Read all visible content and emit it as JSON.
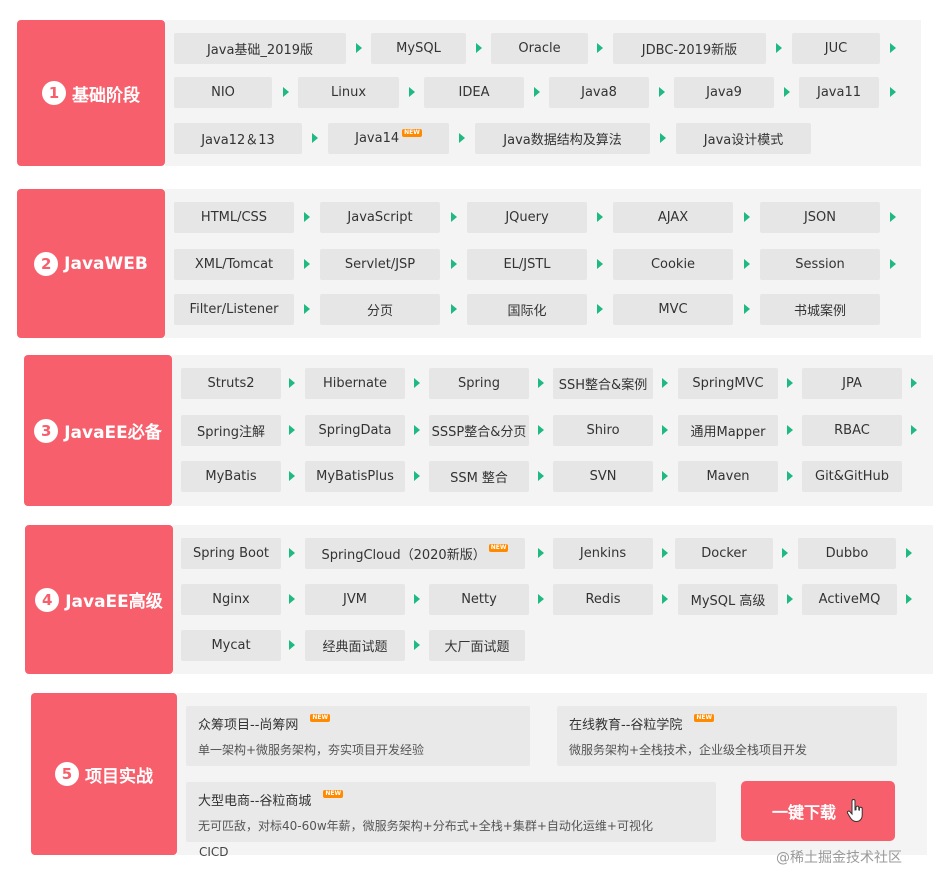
{
  "colors": {
    "accent": "#f85f6c",
    "arrow": "#1fb982",
    "tag_bg": "#e6e6e6",
    "panel_bg": "#f4f4f4",
    "new_badge": "#ff8a00"
  },
  "stages": [
    {
      "number": "1",
      "title": "基础阶段",
      "items": [
        "Java基础_2019版",
        "MySQL",
        "Oracle",
        "JDBC-2019新版",
        "JUC",
        "NIO",
        "Linux",
        "IDEA",
        "Java8",
        "Java9",
        "Java11",
        "Java12＆13",
        "Java14",
        "Java数据结构及算法",
        "Java设计模式"
      ]
    },
    {
      "number": "2",
      "title": "JavaWEB",
      "items": [
        "HTML/CSS",
        "JavaScript",
        "JQuery",
        "AJAX",
        "JSON",
        "XML/Tomcat",
        "Servlet/JSP",
        "EL/JSTL",
        "Cookie",
        "Session",
        "Filter/Listener",
        "分页",
        "国际化",
        "MVC",
        "书城案例"
      ]
    },
    {
      "number": "3",
      "title": "JavaEE必备",
      "items": [
        "Struts2",
        "Hibernate",
        "Spring",
        "SSH整合&案例",
        "SpringMVC",
        "JPA",
        "Spring注解",
        "SpringData",
        "SSSP整合&分页",
        "Shiro",
        "通用Mapper",
        "RBAC",
        "MyBatis",
        "MyBatisPlus",
        "SSM 整合",
        "SVN",
        "Maven",
        "Git&GitHub"
      ]
    },
    {
      "number": "4",
      "title": "JavaEE高级",
      "items": [
        "Spring Boot",
        "SpringCloud（2020新版）",
        "Jenkins",
        "Docker",
        "Dubbo",
        "Nginx",
        "JVM",
        "Netty",
        "Redis",
        "MySQL 高级",
        "ActiveMQ",
        "Mycat",
        "经典面试题",
        "大厂面试题"
      ]
    },
    {
      "number": "5",
      "title": "项目实战"
    }
  ],
  "new_badge": "NEW",
  "projects": [
    {
      "title": "众筹项目--尚筹网",
      "desc": "单一架构+微服务架构，夯实项目开发经验"
    },
    {
      "title": "在线教育--谷粒学院",
      "desc": "微服务架构+全栈技术，企业级全栈项目开发"
    },
    {
      "title": "大型电商--谷粒商城",
      "desc": "无可匹敌，对标40-60w年薪，微服务架构+分布式+全栈+集群+自动化运维+可视化"
    }
  ],
  "extra_line": "CICD",
  "download_button": "一键下载",
  "watermark": "@稀土掘金技术社区"
}
